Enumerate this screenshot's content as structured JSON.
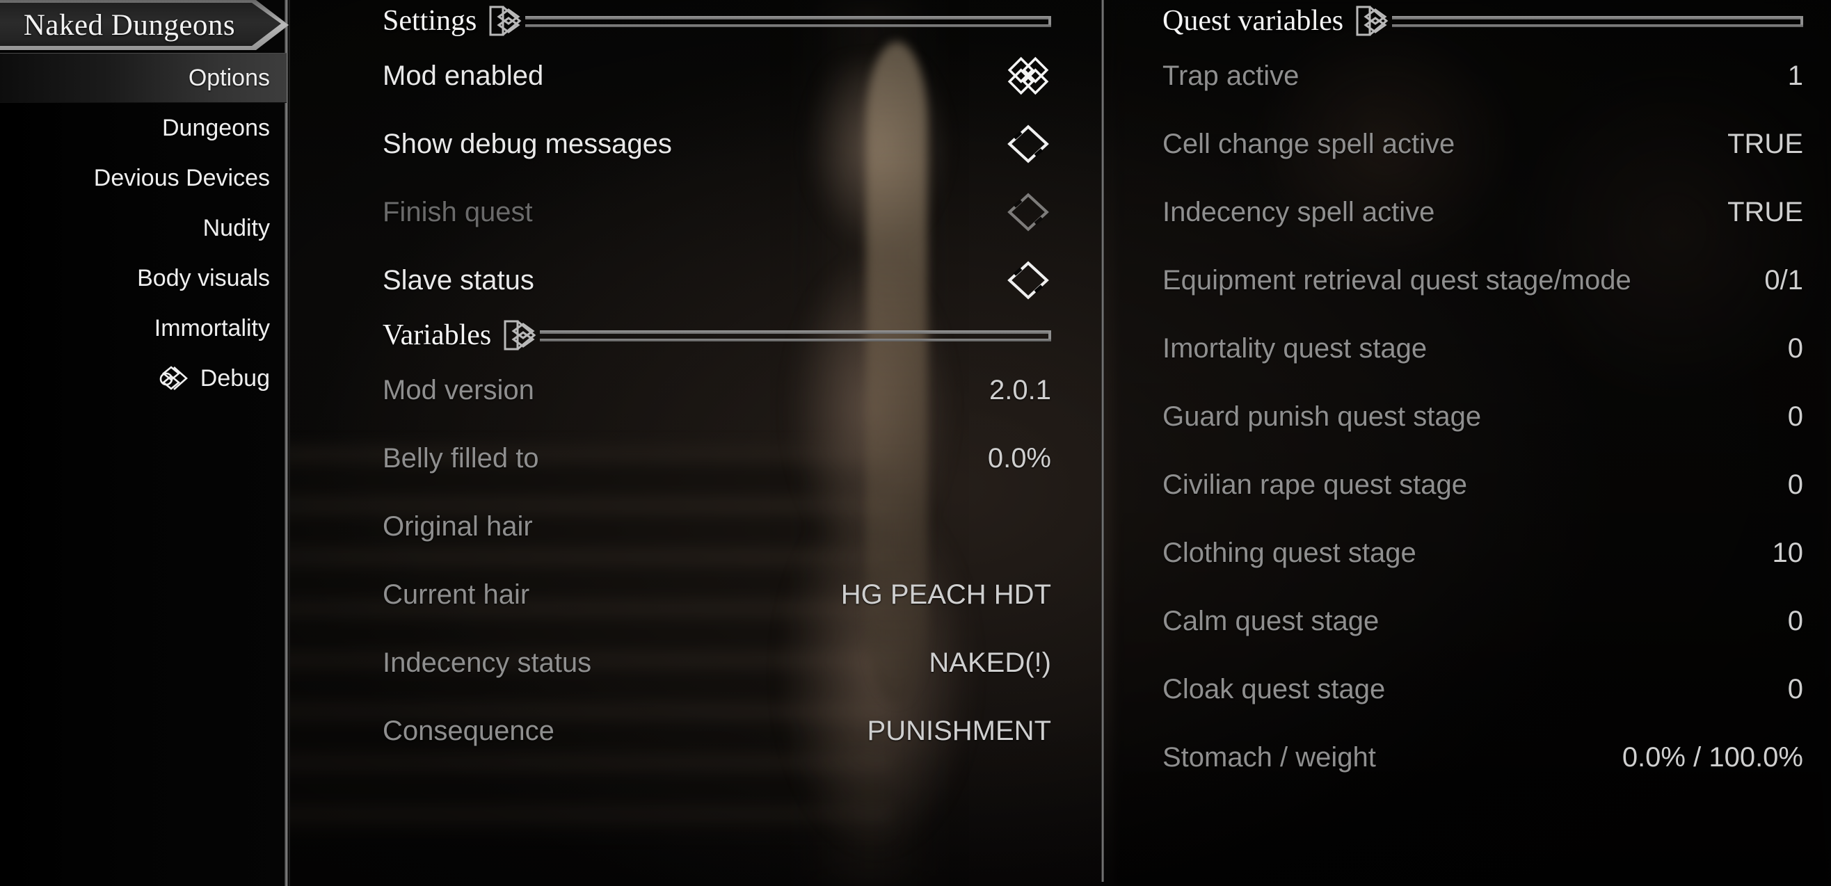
{
  "window": {
    "title": "Naked Dungeons"
  },
  "sidebar": {
    "items": [
      {
        "label": "Options",
        "icon": "",
        "selected": true
      },
      {
        "label": "Dungeons",
        "icon": "",
        "selected": false
      },
      {
        "label": "Devious Devices",
        "icon": "",
        "selected": false
      },
      {
        "label": "Nudity",
        "icon": "",
        "selected": false
      },
      {
        "label": "Body visuals",
        "icon": "",
        "selected": false
      },
      {
        "label": "Immortality",
        "icon": "",
        "selected": false
      },
      {
        "label": "Debug",
        "icon": "current-page-ornament-icon",
        "selected": false
      }
    ]
  },
  "middle_column": {
    "sections": [
      {
        "title": "Settings",
        "ornament": "diamond-knot-icon",
        "type": "toggles",
        "rows": [
          {
            "label": "Mod enabled",
            "control": "checkbox",
            "checked": true,
            "enabled": true
          },
          {
            "label": "Show debug messages",
            "control": "checkbox",
            "checked": false,
            "enabled": true
          },
          {
            "label": "Finish quest",
            "control": "checkbox",
            "checked": false,
            "enabled": false
          },
          {
            "label": "Slave status",
            "control": "checkbox",
            "checked": false,
            "enabled": true
          }
        ]
      },
      {
        "title": "Variables",
        "ornament": "diamond-knot-icon",
        "type": "readouts",
        "rows": [
          {
            "label": "Mod version",
            "value": "2.0.1"
          },
          {
            "label": "Belly filled to",
            "value": "0.0%"
          },
          {
            "label": "Original hair",
            "value": ""
          },
          {
            "label": "Current hair",
            "value": "HG PEACH HDT"
          },
          {
            "label": "Indecency status",
            "value": "NAKED(!)"
          },
          {
            "label": "Consequence",
            "value": "PUNISHMENT"
          }
        ]
      }
    ]
  },
  "right_column": {
    "sections": [
      {
        "title": "Quest variables",
        "ornament": "diamond-knot-icon",
        "type": "readouts",
        "rows": [
          {
            "label": "Trap active",
            "value": "1"
          },
          {
            "label": "Cell change spell active",
            "value": "TRUE"
          },
          {
            "label": "Indecency spell active",
            "value": "TRUE"
          },
          {
            "label": "Equipment retrieval quest stage/mode",
            "value": "0/1"
          },
          {
            "label": "Imortality quest stage",
            "value": "0"
          },
          {
            "label": "Guard punish quest stage",
            "value": "0"
          },
          {
            "label": "Civilian rape quest stage",
            "value": "0"
          },
          {
            "label": "Clothing quest stage",
            "value": "10"
          },
          {
            "label": "Calm quest stage",
            "value": "0"
          },
          {
            "label": "Cloak quest stage",
            "value": "0"
          },
          {
            "label": "Stomach / weight",
            "value": "0.0% / 100.0%"
          }
        ]
      }
    ]
  },
  "colors": {
    "text_bright": "#efefef",
    "text_muted": "#8f8f8f",
    "rule": "#8f8f8f",
    "selected_row": "#3d3d3d",
    "background": "#060605"
  }
}
